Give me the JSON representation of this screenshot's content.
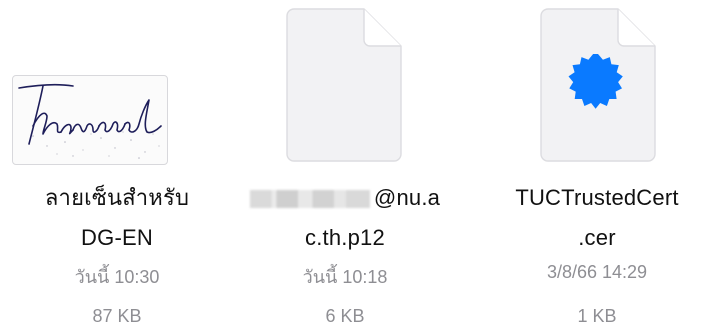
{
  "files": [
    {
      "name_line1": "ลายเซ็นสำหรับ",
      "name_line2": "DG-EN",
      "date": "วันนี้ 10:30",
      "size": "87 KB",
      "thumbnail": "signature-image",
      "signature_text": "Thanawal"
    },
    {
      "name_line1_suffix": "@nu.a",
      "name_line2": "c.th.p12",
      "name_redacted": true,
      "date": "วันนี้ 10:18",
      "size": "6 KB",
      "thumbnail": "blank-document-icon"
    },
    {
      "name_line1": "TUCTrustedCert",
      "name_line2": ".cer",
      "date": "3/8/66 14:29",
      "size": "1 KB",
      "thumbnail": "certificate-document-icon",
      "seal_color": "#0a7aff"
    }
  ],
  "colors": {
    "text_primary": "#111111",
    "text_secondary": "#8e8e93",
    "doc_fill": "#f2f2f4",
    "doc_border": "#dcdce0",
    "seal": "#0a7aff"
  }
}
